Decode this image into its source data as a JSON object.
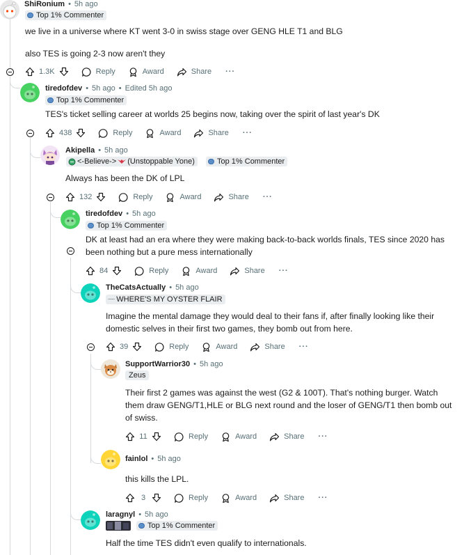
{
  "comments": [
    {
      "username": "ShiRonium",
      "time": "5h ago",
      "flair": "Top 1% Commenter",
      "body": [
        "we live in a universe where KT went 3-0 in swiss stage over GENG HLE T1 and BLG",
        "also TES is going 2-3 now aren't they"
      ],
      "score": "1.3K"
    },
    {
      "username": "tiredofdev",
      "time": "5h ago",
      "edited": "Edited 5h ago",
      "flair": "Top 1% Commenter",
      "body": [
        "TES's ticket selling career at worlds 25 begins now, taking over the spirit of last year's DK"
      ],
      "score": "438"
    },
    {
      "username": "Akipella",
      "time": "5h ago",
      "flair_custom": "<-Believe->",
      "flair_custom2": "(Unstoppable Yone)",
      "flair": "Top 1% Commenter",
      "body": [
        "Always has been the DK of LPL"
      ],
      "score": "132"
    },
    {
      "username": "tiredofdev",
      "time": "5h ago",
      "flair": "Top 1% Commenter",
      "body": [
        "DK at least had an era where they were making back-to-back worlds finals, TES since 2020 has been nothing but a pure mess internationally"
      ],
      "score": "84"
    },
    {
      "username": "TheCatsActually",
      "time": "5h ago",
      "flair_prefix": "~~~",
      "flair": "WHERE'S MY OYSTER FLAIR",
      "body": [
        "Imagine the mental damage they would deal to their fans if, after finally looking like their domestic selves in their first two games, they bomb out from here."
      ],
      "score": "39"
    },
    {
      "username": "SupportWarrior30",
      "time": "5h ago",
      "flair": "Zeus",
      "body": [
        "Their first 2 games was against the west (G2 & 100T). That's nothing burger. Watch them draw GENG/T1,HLE or BLG next round and the loser of GENG/T1 then bomb out of swiss."
      ],
      "score": "11"
    },
    {
      "username": "fainlol",
      "time": "5h ago",
      "body": [
        "this kills the LPL."
      ],
      "score": "3"
    },
    {
      "username": "laragnyl",
      "time": "5h ago",
      "flair": "Top 1% Commenter",
      "body": [
        "Half the time TES didn't even qualify to internationals."
      ]
    }
  ],
  "labels": {
    "reply": "Reply",
    "award": "Award",
    "share": "Share",
    "more": "···",
    "dot": "•"
  },
  "colors": {
    "snoo_green": "#46d160",
    "snoo_teal": "#0dd3bb",
    "snoo_yellow": "#ffd635",
    "line": "#d7dadc",
    "meta": "#576f76"
  }
}
